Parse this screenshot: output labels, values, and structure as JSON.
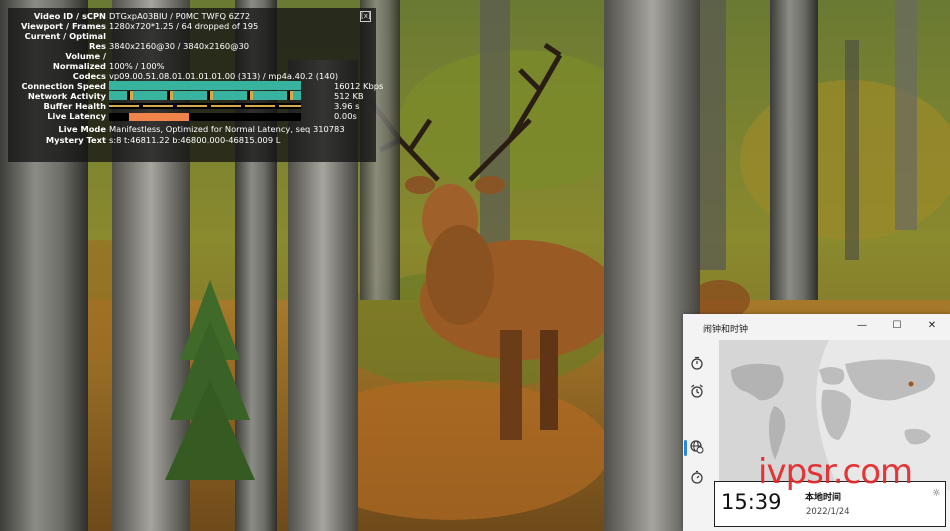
{
  "stats": {
    "close_label": "[x]",
    "rows": [
      {
        "label": "Video ID / sCPN",
        "value": "DTGxpA03BIU / P0MC TWFQ 6Z72"
      },
      {
        "label": "Viewport / Frames",
        "value": "1280x720*1.25 / 64 dropped of 195"
      },
      {
        "label": "Current / Optimal",
        "value": ""
      },
      {
        "label": "Res",
        "value": "3840x2160@30 / 3840x2160@30"
      },
      {
        "label": "Volume /",
        "value": ""
      },
      {
        "label": "Normalized",
        "value": "100% / 100%"
      },
      {
        "label": "Codecs",
        "value": "vp09.00.51.08.01.01.01.01.00 (313) / mp4a.40.2 (140)"
      },
      {
        "label": "Connection Speed",
        "value": "16012 Kbps"
      },
      {
        "label": "Network Activity",
        "value": "512 KB"
      },
      {
        "label": "Buffer Health",
        "value": "3.96 s"
      },
      {
        "label": "Live Latency",
        "value": "0.00s"
      },
      {
        "label": "Live Mode",
        "value": "Manifestless, Optimized for Normal Latency, seq 310783"
      },
      {
        "label": "Mystery Text",
        "value": "s:8 t:46811.22 b:46800.000-46815.009 L"
      }
    ]
  },
  "clock_app": {
    "title": "闹钟和时钟",
    "minimize": "—",
    "maximize": "☐",
    "close": "✕",
    "nav_icons": [
      "timer-icon",
      "alarm-icon",
      "world-clock-icon",
      "stopwatch-icon"
    ],
    "location_card": {
      "time": "15:39",
      "name": "本地时间",
      "date": "2022/1/24"
    }
  },
  "watermark": "ivpsr.com",
  "colors": {
    "teal_bar": "#38b3a0",
    "orange_bar": "#f0834a",
    "accent_blue": "#2b88d8",
    "watermark_red": "#e22628"
  }
}
